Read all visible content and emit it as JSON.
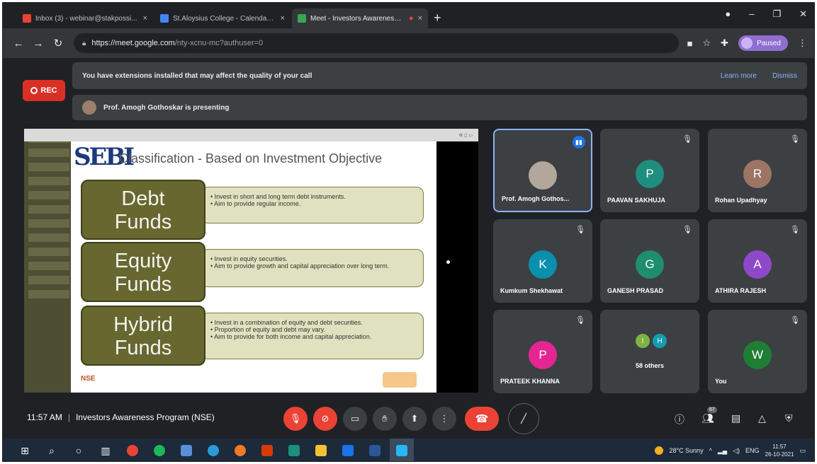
{
  "browser": {
    "tabs": [
      {
        "title": "Inbox (3) - webinar@stakpossi...",
        "favicon_color": "#ea4335",
        "active": false
      },
      {
        "title": "St.Aloysius College - Calendar - ...",
        "favicon_color": "#4285f4",
        "active": false
      },
      {
        "title": "Meet - Investors Awareness ...",
        "favicon_color": "#34a853",
        "active": true
      }
    ],
    "new_tab": "+",
    "url_host": "https://meet.google.com",
    "url_path": "/nty-xcnu-mc?authuser=0",
    "profile_label": "Paused"
  },
  "meet": {
    "rec_label": "REC",
    "extension_warning": "You have extensions installed that may affect the quality of your call",
    "learn_more": "Learn more",
    "dismiss": "Dismiss",
    "presenting_text": "Prof. Amogh Gothoskar is presenting",
    "meeting_time": "11:57 AM",
    "meeting_title": "Investors Awareness Program (NSE)",
    "participant_count": "67"
  },
  "slide": {
    "logo_text": "SEBI",
    "title": "Classification - Based on Investment Objective",
    "funds": [
      {
        "name_line1": "Debt",
        "name_line2": "Funds",
        "points": [
          "Invest in short and long term debt instruments.",
          "Aim to provide regular income."
        ]
      },
      {
        "name_line1": "Equity",
        "name_line2": "Funds",
        "points": [
          "Invest in equity securities.",
          "Aim to provide growth and capital appreciation over long term."
        ]
      },
      {
        "name_line1": "Hybrid",
        "name_line2": "Funds",
        "points": [
          "Invest in a combination of equity and debt securities.",
          "Proportion of equity and debt may vary.",
          "Aim to provide for both income and capital appreciation."
        ]
      }
    ],
    "footer_left": "NSE"
  },
  "participants": [
    {
      "name": "Prof. Amogh Gothos...",
      "initial": "",
      "color": "#b2a79a",
      "speaking": true
    },
    {
      "name": "PAAVAN SAKHUJA",
      "initial": "P",
      "color": "#1e8e7e",
      "speaking": false
    },
    {
      "name": "Rohan Upadhyay",
      "initial": "R",
      "color": "#9c7565",
      "speaking": false
    },
    {
      "name": "Kumkum Shekhawat",
      "initial": "K",
      "color": "#0a8fae",
      "speaking": false
    },
    {
      "name": "GANESH PRASAD",
      "initial": "G",
      "color": "#1e8e6e",
      "speaking": false
    },
    {
      "name": "ATHIRA RAJESH",
      "initial": "A",
      "color": "#8e49c9",
      "speaking": false
    },
    {
      "name": "PRATEEK KHANNA",
      "initial": "P",
      "color": "#e52592",
      "speaking": false
    },
    {
      "name": "58 others",
      "initial": "",
      "color": "",
      "speaking": false
    },
    {
      "name": "You",
      "initial": "W",
      "color": "#1e7e34",
      "speaking": false
    }
  ],
  "others_avatars": [
    {
      "initial": "I",
      "color": "#7cb342"
    },
    {
      "initial": "H",
      "color": "#129eaf"
    }
  ],
  "taskbar": {
    "weather": "28°C Sunny",
    "lang": "ENG",
    "time": "11:57",
    "date": "26-10-2021"
  }
}
